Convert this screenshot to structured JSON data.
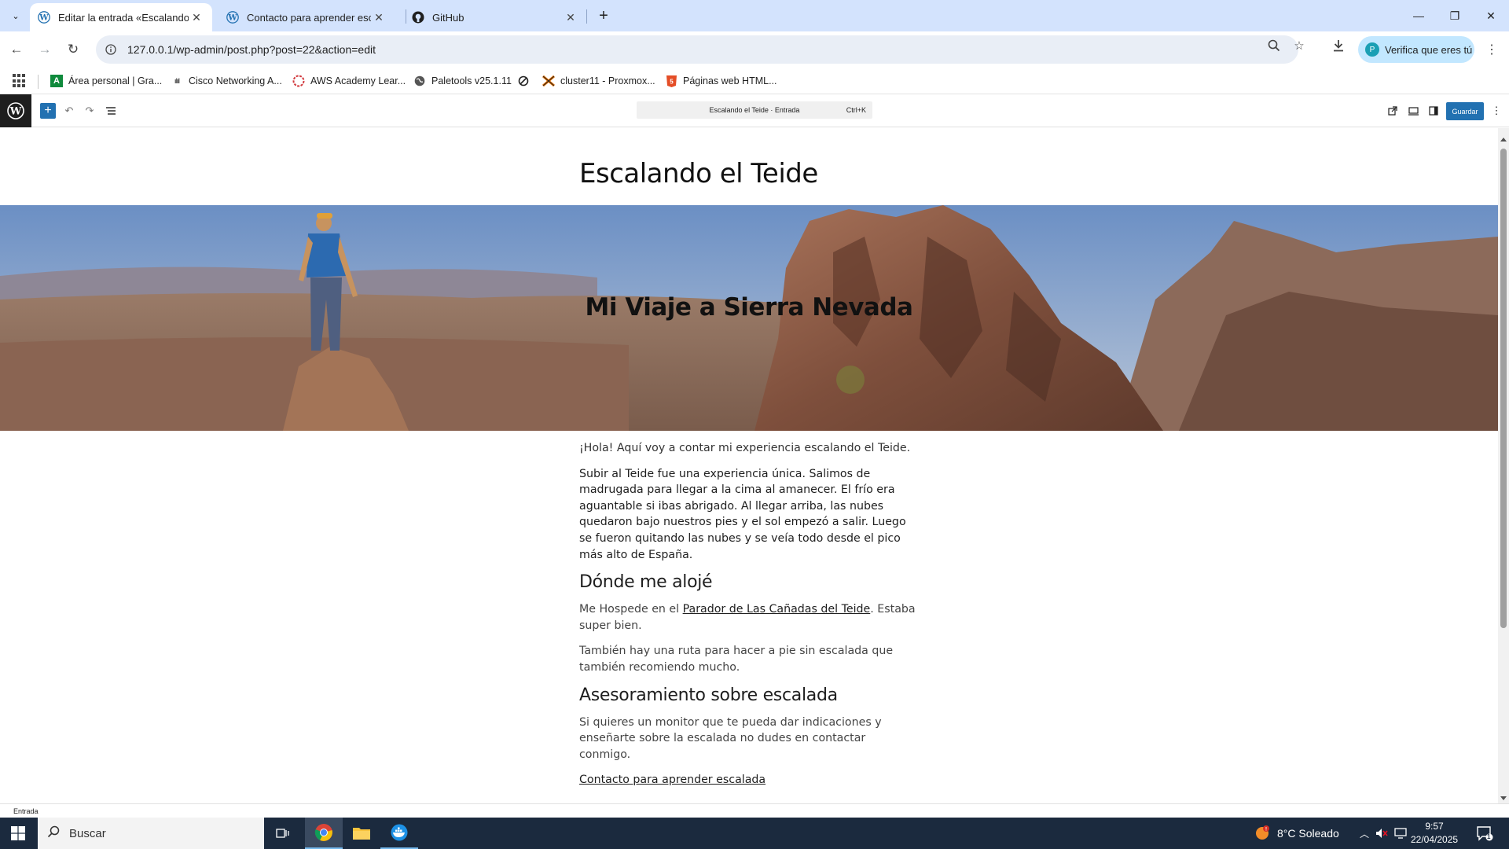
{
  "browser": {
    "tabs": [
      {
        "title": "Editar la entrada «Escalando el Teide»",
        "icon": "wordpress-icon",
        "active": true
      },
      {
        "title": "Contacto para aprender escalada",
        "icon": "wordpress-icon",
        "active": false
      },
      {
        "title": "GitHub",
        "icon": "github-icon",
        "active": false
      }
    ],
    "url": "127.0.0.1/wp-admin/post.php?post=22&action=edit",
    "profile_label": "Verifica que eres tú",
    "bookmarks": [
      {
        "label": "Área personal | Gra...",
        "icon": "moodle-a-icon"
      },
      {
        "label": "Cisco Networking A...",
        "icon": "cisco-icon"
      },
      {
        "label": "AWS Academy Lear...",
        "icon": "aws-academy-icon"
      },
      {
        "label": "Paletools v25.1.11",
        "icon": "globe-icon"
      },
      {
        "label": "",
        "icon": "no-entry-icon"
      },
      {
        "label": "cluster11 - Proxmox...",
        "icon": "proxmox-icon"
      },
      {
        "label": "Páginas web HTML...",
        "icon": "html5-icon"
      }
    ]
  },
  "editor": {
    "doc_title": "Escalando el Teide · Entrada",
    "shortcut": "Ctrl+K",
    "save_label": "Guardar",
    "status": "Entrada"
  },
  "post": {
    "title": "Escalando el Teide",
    "cover_heading": "Mi Viaje a Sierra Nevada",
    "intro": "¡Hola! Aquí voy a contar mi experiencia escalando el Teide.",
    "paragraph1": "Subir al Teide fue una experiencia única. Salimos de madrugada para llegar a la cima al amanecer. El frío era aguantable si ibas abrigado. Al llegar arriba, las nubes quedaron bajo nuestros pies y el sol empezó a salir. Luego se fueron quitando las nubes y se veía todo desde el pico más alto de España.",
    "heading_stay": "Dónde me alojé",
    "stay_before": "Me Hospede en el ",
    "stay_link": "Parador de Las Cañadas del Teide",
    "stay_after": ". Estaba super bien.",
    "route": "También hay una ruta para hacer a pie sin escalada que también recomiendo mucho.",
    "heading_advice": "Asesoramiento sobre escalada",
    "advice": "Si quieres un monitor que te pueda dar indicaciones y enseñarte sobre la escalada no dudes en contactar conmigo.",
    "contact_link": "Contacto para aprender escalada"
  },
  "taskbar": {
    "search_placeholder": "Buscar",
    "weather": "8°C  Soleado",
    "time": "9:57",
    "date": "22/04/2025",
    "notification_count": "1"
  },
  "colors": {
    "tab_strip": "#d3e3fd",
    "wp_accent": "#2271b1",
    "taskbar": "#1b2a3e"
  }
}
